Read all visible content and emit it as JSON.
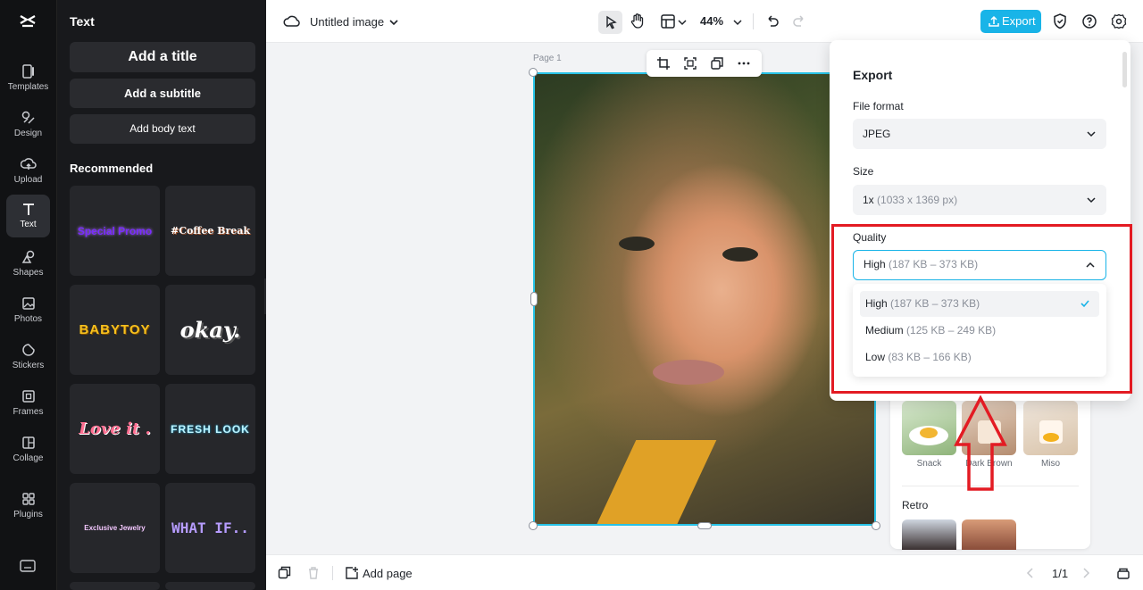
{
  "rail": {
    "items": [
      {
        "label": "Templates",
        "icon": "templates-icon"
      },
      {
        "label": "Design",
        "icon": "design-icon"
      },
      {
        "label": "Upload",
        "icon": "upload-icon"
      },
      {
        "label": "Text",
        "icon": "text-icon"
      },
      {
        "label": "Shapes",
        "icon": "shapes-icon"
      },
      {
        "label": "Photos",
        "icon": "photos-icon"
      },
      {
        "label": "Stickers",
        "icon": "stickers-icon"
      },
      {
        "label": "Frames",
        "icon": "frames-icon"
      },
      {
        "label": "Collage",
        "icon": "collage-icon"
      },
      {
        "label": "Plugins",
        "icon": "plugins-icon"
      }
    ],
    "active": "Text"
  },
  "panel": {
    "title": "Text",
    "add_title": "Add a title",
    "add_subtitle": "Add a subtitle",
    "add_body": "Add body text",
    "recommended": "Recommended",
    "presets": [
      "Special Promo",
      "#Coffee Break",
      "BABYTOY",
      "okay.",
      "Love it .",
      "FRESH LOOK",
      "Exclusive Jewelry",
      "WHAT IF.."
    ]
  },
  "topbar": {
    "doc_title": "Untitled image",
    "zoom": "44%",
    "export_label": "Export"
  },
  "canvas": {
    "page_label": "Page 1"
  },
  "export": {
    "title": "Export",
    "file_format_label": "File format",
    "file_format_value": "JPEG",
    "size_label": "Size",
    "size_value": "1x",
    "size_detail": "(1033 x 1369 px)",
    "quality_label": "Quality",
    "quality_value": "High",
    "quality_detail": "(187 KB – 373 KB)",
    "options": [
      {
        "name": "High",
        "detail": "(187 KB – 373 KB)",
        "selected": true
      },
      {
        "name": "Medium",
        "detail": "(125 KB – 249 KB)",
        "selected": false
      },
      {
        "name": "Low",
        "detail": "(83 KB – 166 KB)",
        "selected": false
      }
    ]
  },
  "filters": {
    "items": [
      "Snack",
      "Dark Brown",
      "Miso"
    ],
    "retro_title": "Retro"
  },
  "bottombar": {
    "add_page": "Add page",
    "pager": "1/1"
  },
  "colors": {
    "accent": "#19b4e8",
    "annotation": "#e31b23"
  }
}
